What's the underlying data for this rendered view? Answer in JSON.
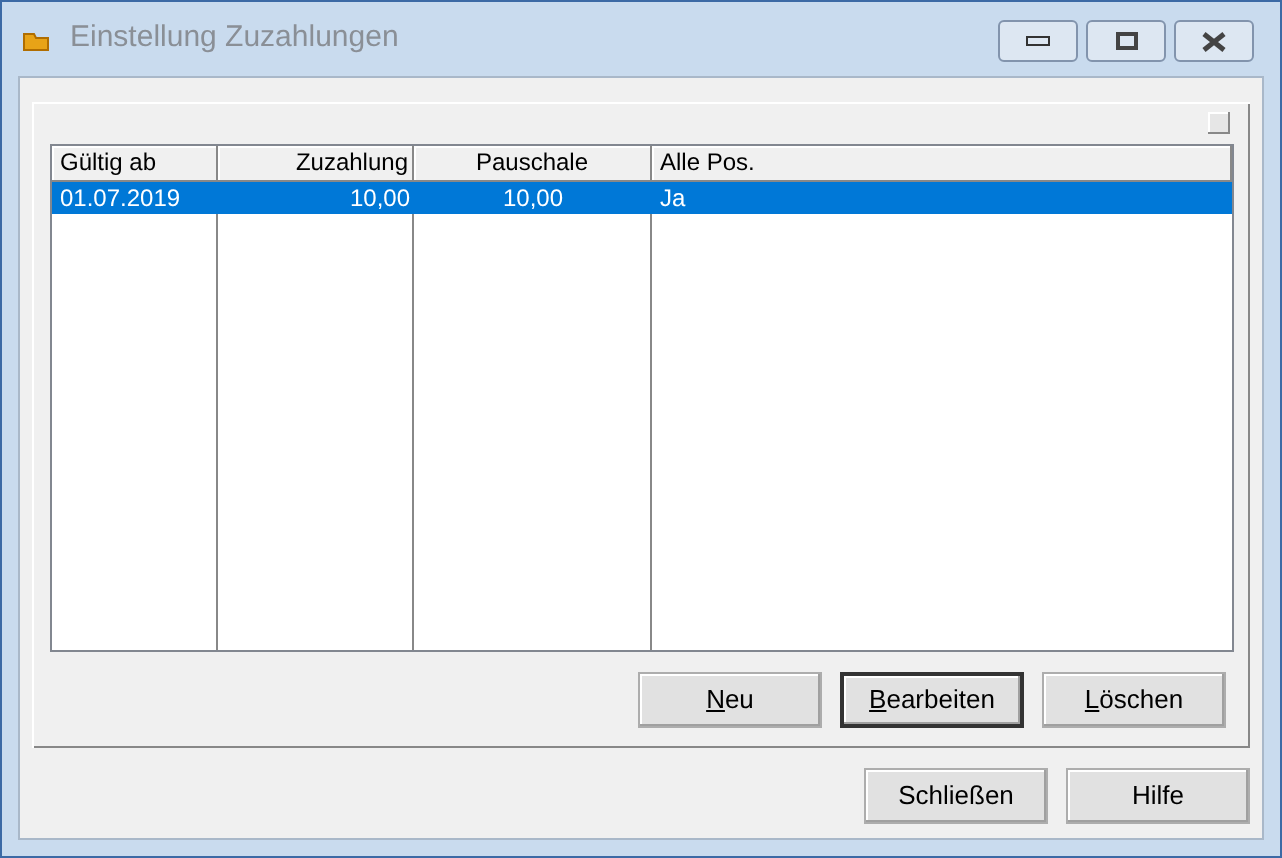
{
  "window": {
    "title": "Einstellung Zuzahlungen"
  },
  "table": {
    "columns": [
      {
        "label": "Gültig ab",
        "kind": "left"
      },
      {
        "label": "Zuzahlung",
        "kind": "right"
      },
      {
        "label": "Pauschale",
        "kind": "center"
      },
      {
        "label": "Alle Pos.",
        "kind": "left"
      }
    ],
    "rows": [
      {
        "selected": true,
        "cells": [
          "01.07.2019",
          "10,00",
          "10,00",
          "Ja"
        ]
      }
    ]
  },
  "list_buttons": [
    {
      "mnemonic": "N",
      "rest": "eu",
      "default": false
    },
    {
      "mnemonic": "B",
      "rest": "earbeiten",
      "default": true
    },
    {
      "mnemonic": "L",
      "rest": "öschen",
      "default": false
    }
  ],
  "dialog_buttons": [
    {
      "label": "Schließen"
    },
    {
      "label": "Hilfe"
    }
  ]
}
